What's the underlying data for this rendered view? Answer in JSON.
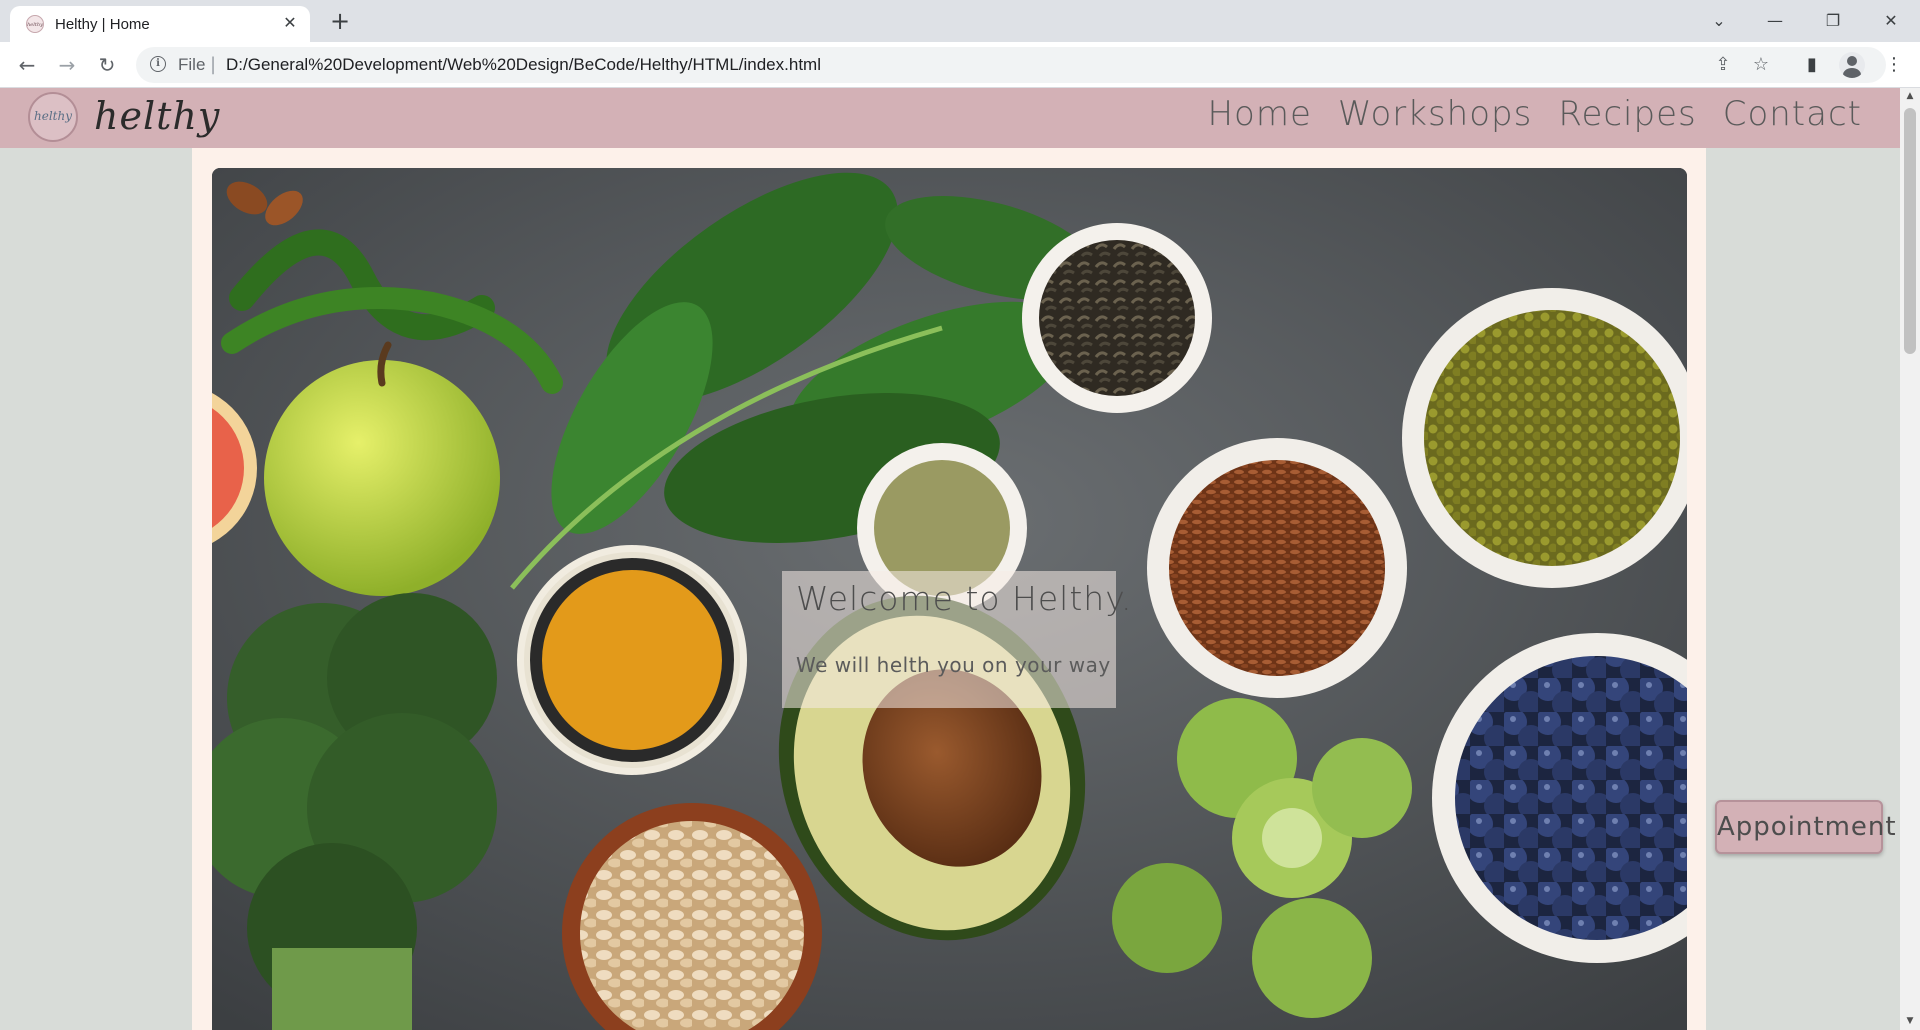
{
  "browser": {
    "tab_title": "Helthy | Home",
    "favicon_text": "helthy",
    "url_scheme": "File",
    "url": "D:/General%20Development/Web%20Design/BeCode/Helthy/HTML/index.html"
  },
  "site": {
    "logo_badge_text": "helthy",
    "logo_text": "helthy",
    "nav": [
      "Home",
      "Workshops",
      "Recipes",
      "Contact"
    ]
  },
  "hero": {
    "title": "Welcome to Helthy.",
    "subtitle": "We will helth you on your way"
  },
  "appointment_label": "Appointment",
  "colors": {
    "header_bg": "#d3b1b6",
    "panel_bg": "#fdf1ea",
    "page_bg": "#d8dcd8"
  },
  "icons": [
    "tab-close-icon",
    "new-tab-icon",
    "back-icon",
    "forward-icon",
    "reload-icon",
    "info-icon",
    "share-icon",
    "star-icon",
    "sidebar-icon",
    "profile-icon",
    "menu-icon"
  ]
}
